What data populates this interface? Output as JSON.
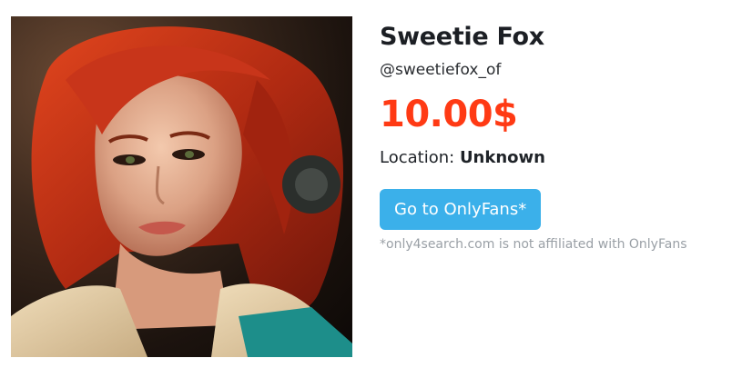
{
  "profile": {
    "name": "Sweetie Fox",
    "handle": "@sweetiefox_of",
    "price": "10.00$",
    "location_label": "Location:",
    "location_value": "Unknown"
  },
  "cta": {
    "button_label": "Go to OnlyFans*",
    "disclaimer": "*only4search.com is not affiliated with OnlyFans"
  },
  "colors": {
    "price": "#ff3a14",
    "button": "#3bb0ea",
    "disclaimer": "#9aa0a6"
  }
}
